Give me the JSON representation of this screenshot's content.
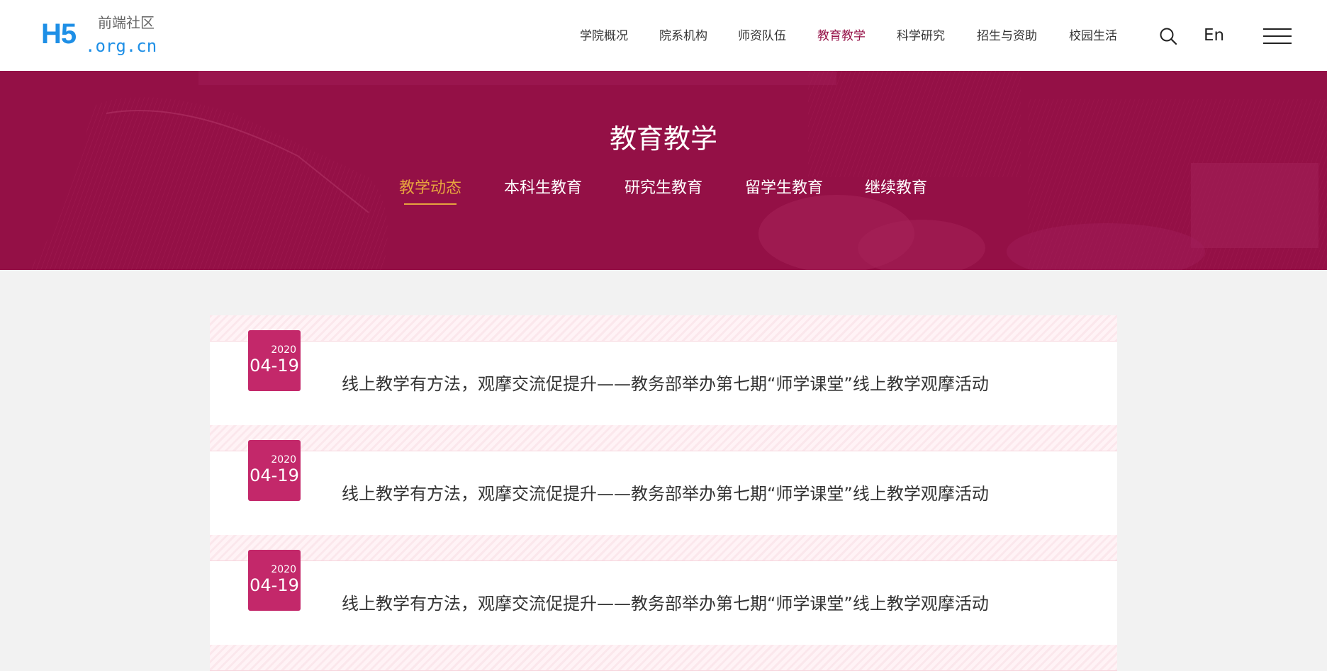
{
  "logo": {
    "mark": "H5",
    "cn": "前端社区",
    "domain": ".org.cn"
  },
  "nav": {
    "items": [
      {
        "label": "学院概况"
      },
      {
        "label": "院系机构"
      },
      {
        "label": "师资队伍"
      },
      {
        "label": "教育教学",
        "active": true
      },
      {
        "label": "科学研究"
      },
      {
        "label": "招生与资助"
      },
      {
        "label": "校园生活"
      }
    ],
    "search_icon": "search-icon",
    "lang_label": "En",
    "menu_icon": "hamburger-menu-icon"
  },
  "banner": {
    "title": "教育教学",
    "tabs": [
      {
        "label": "教学动态",
        "active": true
      },
      {
        "label": "本科生教育"
      },
      {
        "label": "研究生教育"
      },
      {
        "label": "留学生教育"
      },
      {
        "label": "继续教育"
      }
    ]
  },
  "news": [
    {
      "year": "2020",
      "date": "04-19",
      "title": "线上教学有方法，观摩交流促提升——教务部举办第七期“师学课堂”线上教学观摩活动"
    },
    {
      "year": "2020",
      "date": "04-19",
      "title": "线上教学有方法，观摩交流促提升——教务部举办第七期“师学课堂”线上教学观摩活动"
    },
    {
      "year": "2020",
      "date": "04-19",
      "title": "线上教学有方法，观摩交流促提升——教务部举办第七期“师学课堂”线上教学观摩活动"
    }
  ],
  "colors": {
    "brand": "#951147",
    "accent": "#e6a33e",
    "date_badge": "#c3286a",
    "logo_blue": "#1e8fe6"
  }
}
